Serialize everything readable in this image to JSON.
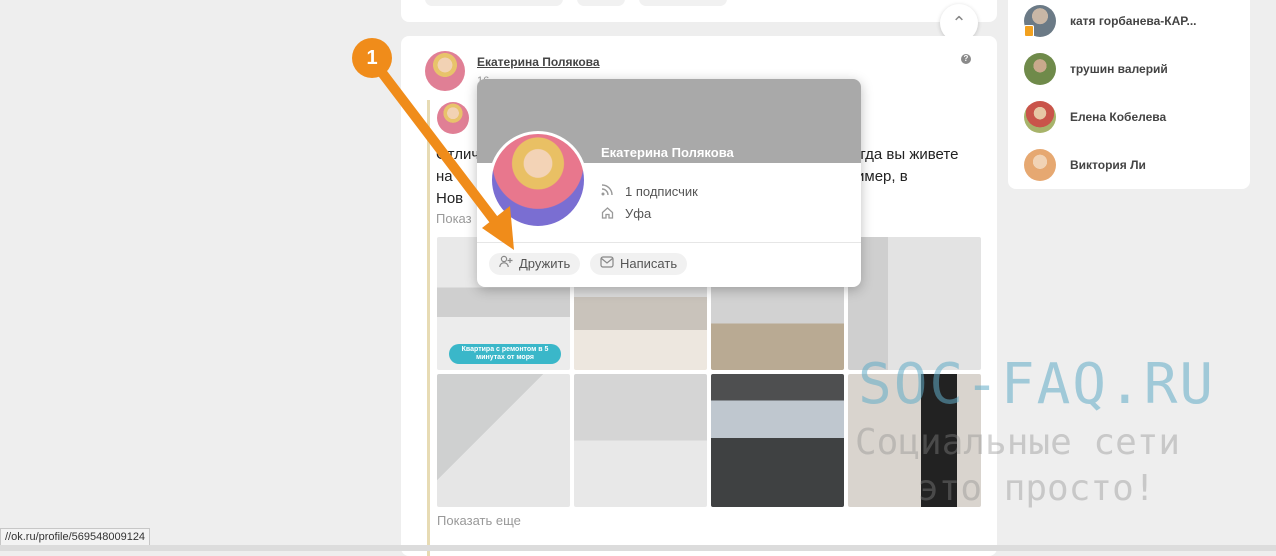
{
  "post": {
    "author_name": "Екатерина Полякова",
    "author_sub": "16",
    "repost_author": "С",
    "text_lines": [
      "Отлично",
      "на т",
      "Нов"
    ],
    "text_right_lines": [
      "огда вы живете",
      "имер, в"
    ],
    "show_more_text": "Показ",
    "photo_caption": "Квартира с ремонтом в 5 минутах от моря",
    "show_more_photos": "Показать еще"
  },
  "popup": {
    "name": "Екатерина Полякова",
    "subscribers": "1 подписчик",
    "city": "Уфа",
    "add_friend_label": "Дружить",
    "write_label": "Написать"
  },
  "annotation": {
    "badge": "1",
    "color": "#f08c1a"
  },
  "friends": [
    {
      "name": "катя горбанева-КАР..."
    },
    {
      "name": "трушин валерий"
    },
    {
      "name": "Елена Кобелева"
    },
    {
      "name": "Виктория Ли"
    }
  ],
  "watermark": {
    "title": "SOC-FAQ.RU",
    "line1": "Социальные сети",
    "line2": "это просто!"
  },
  "status_bar": {
    "url": "//ok.ru/profile/569548009124"
  },
  "icons": {
    "scroll_up": "chevron-up-icon",
    "rss": "rss-icon",
    "home": "home-icon",
    "add_friend": "add-user-icon",
    "mail": "mail-icon",
    "help": "help-icon"
  }
}
